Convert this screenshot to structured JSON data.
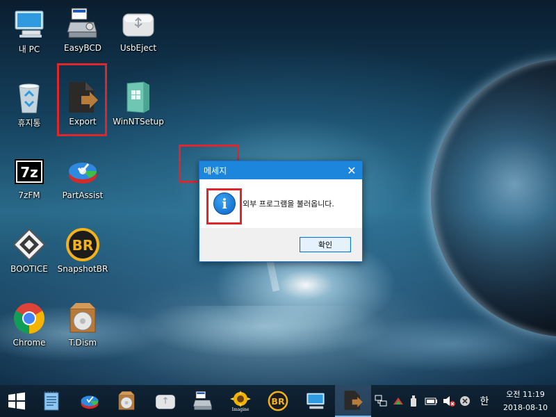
{
  "desktop": {
    "icons": [
      {
        "label": "내 PC",
        "icon": "computer-icon"
      },
      {
        "label": "EasyBCD",
        "icon": "easybcd-icon"
      },
      {
        "label": "UsbEject",
        "icon": "usb-drive-icon"
      },
      {
        "label": "휴지통",
        "icon": "recycle-bin-icon"
      },
      {
        "label": "Export",
        "icon": "export-icon",
        "highlighted": true
      },
      {
        "label": "WinNTSetup",
        "icon": "winntsetup-icon"
      },
      {
        "label": "7zFM",
        "icon": "7zip-icon"
      },
      {
        "label": "PartAssist",
        "icon": "partassist-icon"
      },
      {
        "label": "BOOTICE",
        "icon": "bootice-icon"
      },
      {
        "label": "SnapshotBR",
        "icon": "snapshotbr-icon"
      },
      {
        "label": "Chrome",
        "icon": "chrome-icon"
      },
      {
        "label": "T.Dism",
        "icon": "tdism-icon"
      }
    ],
    "highlight_color": "#e0262b"
  },
  "dialog": {
    "title": "메세지",
    "message": "외부 프로그램을 불러옵니다.",
    "ok_label": "확인",
    "icon": "info-icon",
    "icon_glyph": "i",
    "close_glyph": "✕",
    "title_color": "#1c86dc"
  },
  "taskbar": {
    "pinned": [
      "start-icon",
      "notepad-icon",
      "partassist-icon",
      "tdism-icon",
      "usb-drive-icon",
      "easybcd-icon",
      "imagine-icon",
      "snapshotbr-icon",
      "computer-icon",
      "export-icon"
    ],
    "imagine_label": "Imagine",
    "snapshot_label": "BR",
    "tray": [
      "network-icon",
      "safely-remove-icon",
      "usb-icon",
      "battery-icon",
      "volume-muted-icon",
      "close-circle-icon"
    ],
    "ime_label": "한",
    "clock_time": "오전 11:19",
    "clock_date": "2018-08-10"
  }
}
